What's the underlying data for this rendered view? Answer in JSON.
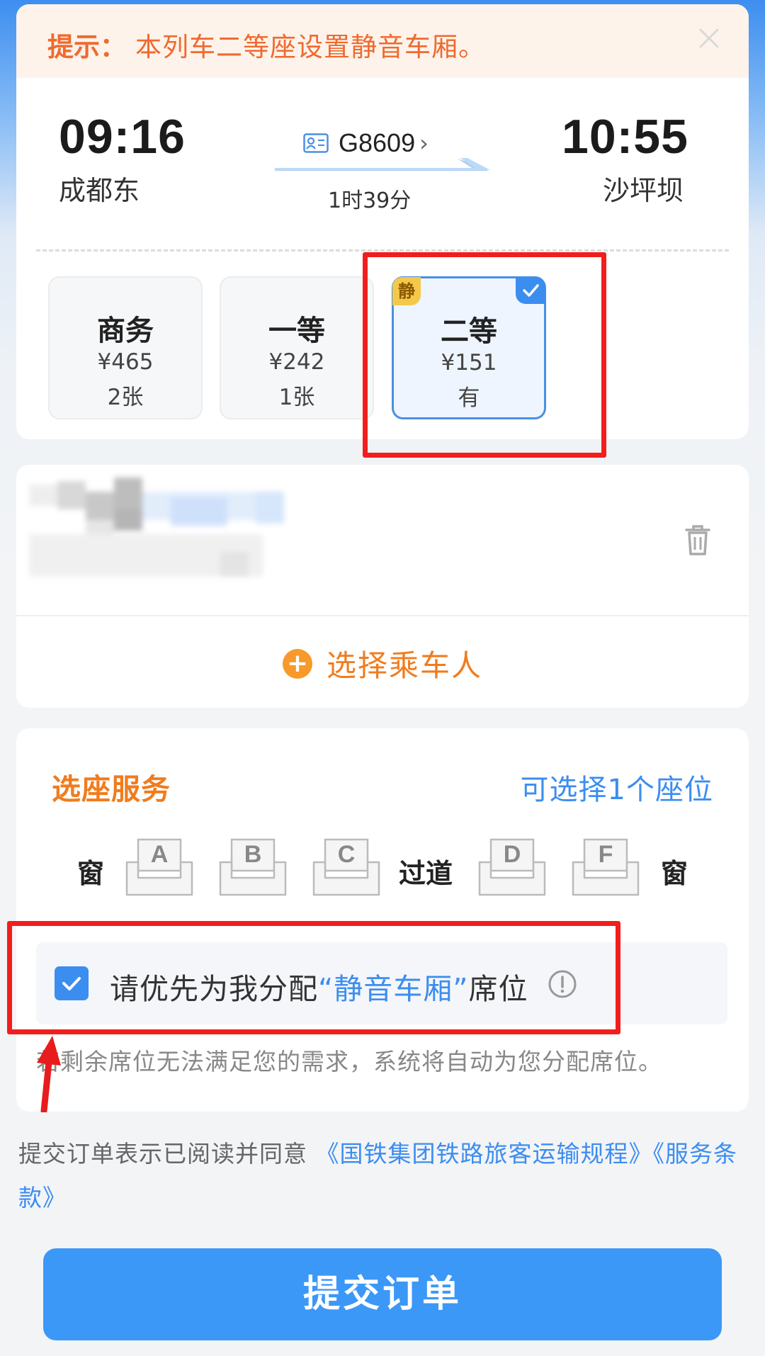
{
  "notice": {
    "prefix": "提示：",
    "text": "本列车二等座设置静音车厢。",
    "close_icon": "close-icon"
  },
  "trip": {
    "depart_time": "09:16",
    "depart_station": "成都东",
    "arrive_time": "10:55",
    "arrive_station": "沙坪坝",
    "train_no": "G8609",
    "duration": "1时39分"
  },
  "seat_classes": [
    {
      "name": "商务",
      "price": "¥465",
      "stock": "2张",
      "selected": false
    },
    {
      "name": "一等",
      "price": "¥242",
      "stock": "1张",
      "selected": false
    },
    {
      "name": "二等",
      "price": "¥151",
      "stock": "有",
      "selected": true,
      "tag": "静"
    }
  ],
  "passenger": {
    "add_label": "选择乘车人"
  },
  "seat_service": {
    "title": "选座服务",
    "count_text": "可选择1个座位",
    "window_left": "窗",
    "aisle": "过道",
    "window_right": "窗",
    "seats_left": [
      "A",
      "B",
      "C"
    ],
    "seats_right": [
      "D",
      "F"
    ],
    "quiet_pref_before": "请优先为我分配",
    "quiet_pref_highlight": "“静音车厢”",
    "quiet_pref_after": "席位",
    "quiet_pref_checked": true,
    "note": "若剩余席位无法满足您的需求，系统将自动为您分配席位。"
  },
  "agreement": {
    "text": "提交订单表示已阅读并同意",
    "link1": "《国铁集团铁路旅客运输规程》",
    "link2": "《服务条款》"
  },
  "submit_label": "提交订单",
  "colors": {
    "accent_blue": "#3c8df0",
    "accent_orange": "#f07c1e",
    "annotation_red": "#f21d1d"
  }
}
